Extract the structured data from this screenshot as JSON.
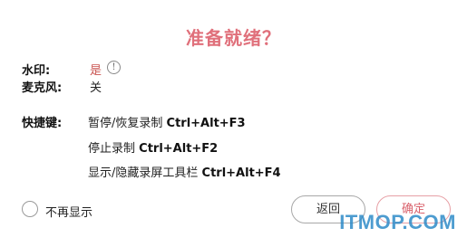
{
  "dialog": {
    "title": "准备就绪？",
    "watermark_label": "水印:",
    "watermark_value": "是",
    "info_glyph": "!",
    "mic_label": "麦克风:",
    "mic_value": "关",
    "shortcuts_label": "快捷键:",
    "shortcuts": [
      {
        "action": "暂停/恢复录制",
        "keys": "Ctrl+Alt+F3"
      },
      {
        "action": "停止录制",
        "keys": "Ctrl+Alt+F2"
      },
      {
        "action": "显示/隐藏录屏工具栏",
        "keys": "Ctrl+Alt+F4"
      }
    ],
    "dont_show_again": "不再显示",
    "back_button": "返回",
    "ok_button": "确定",
    "site_watermark": "ITMOP.COM"
  },
  "colors": {
    "title": "#e0707b",
    "accent": "#c9534f",
    "ok_border": "#e7a0a6",
    "site_watermark": "#2e8bc8"
  },
  "icons": {
    "info": "info-icon",
    "checkbox": "radio-checkbox-icon"
  }
}
